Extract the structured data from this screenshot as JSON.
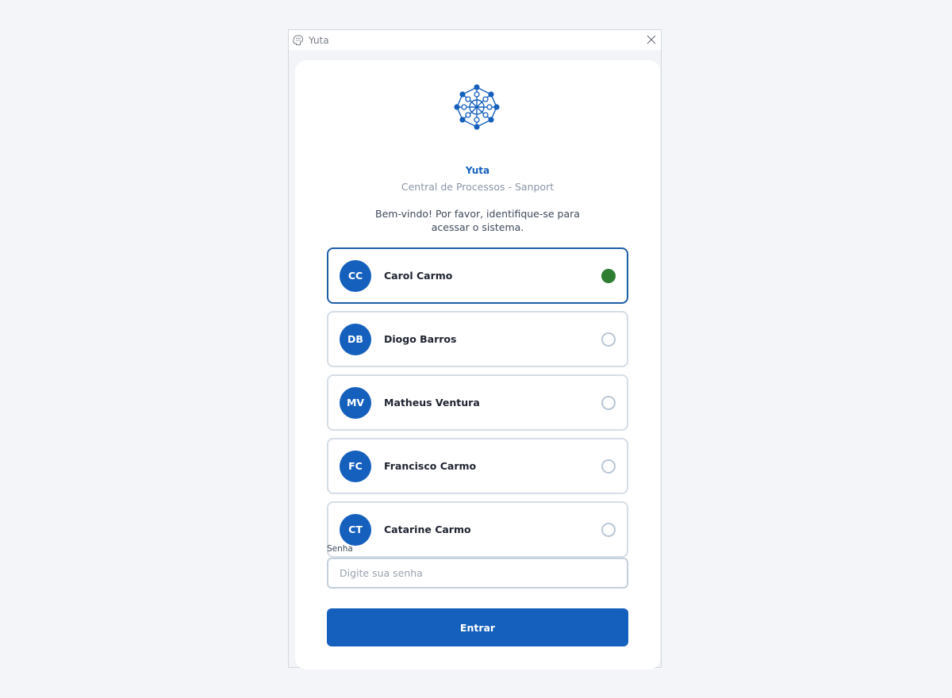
{
  "window": {
    "title": "Yuta",
    "app_icon": "brain-icon",
    "close_icon": "close-icon"
  },
  "header": {
    "logo_icon": "network-wheel-logo",
    "brand": "Yuta",
    "subtitle": "Central de Processos - Sanport",
    "welcome": "Bem-vindo! Por favor, identifique-se para acessar o sistema."
  },
  "users": [
    {
      "initials": "CC",
      "name": "Carol Carmo",
      "selected": true
    },
    {
      "initials": "DB",
      "name": "Diogo Barros",
      "selected": false
    },
    {
      "initials": "MV",
      "name": "Matheus Ventura",
      "selected": false
    },
    {
      "initials": "FC",
      "name": "Francisco Carmo",
      "selected": false
    },
    {
      "initials": "CT",
      "name": "Catarine Carmo",
      "selected": false
    }
  ],
  "password": {
    "label": "Senha",
    "value": "",
    "placeholder": "Digite sua senha"
  },
  "submit": {
    "label": "Entrar"
  },
  "colors": {
    "primary": "#1560bd",
    "selected_border": "#1e5fa8",
    "selected_indicator": "#2e7d32",
    "unselected_border": "#d5dde6",
    "background": "#f3f5f8"
  }
}
